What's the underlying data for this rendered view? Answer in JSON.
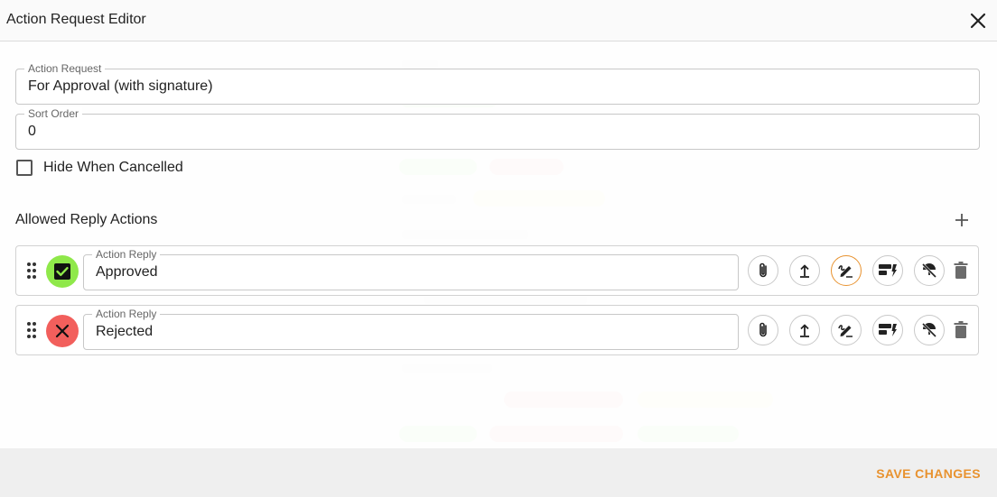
{
  "dialog": {
    "title": "Action Request Editor"
  },
  "fields": {
    "action_request": {
      "label": "Action Request",
      "value": "For Approval (with signature)"
    },
    "sort_order": {
      "label": "Sort Order",
      "value": "0"
    }
  },
  "hide_when_cancelled": {
    "label": "Hide When Cancelled",
    "checked": false
  },
  "allowed_replies": {
    "title": "Allowed Reply Actions",
    "items": [
      {
        "label": "Action Reply",
        "value": "Approved",
        "status_icon": "check-box-icon",
        "status_color": "#8fe84a",
        "active_button": "signature-icon"
      },
      {
        "label": "Action Reply",
        "value": "Rejected",
        "status_icon": "close-icon",
        "status_color": "#f25f5c",
        "active_button": null
      }
    ],
    "row_buttons": [
      "attachment-icon",
      "upload-icon",
      "signature-icon",
      "form-icon",
      "umbrella-off-icon",
      "delete-icon"
    ]
  },
  "footer": {
    "save_label": "SAVE CHANGES"
  },
  "colors": {
    "accent": "#e8922f",
    "approve": "#8fe84a",
    "reject": "#f25f5c"
  }
}
